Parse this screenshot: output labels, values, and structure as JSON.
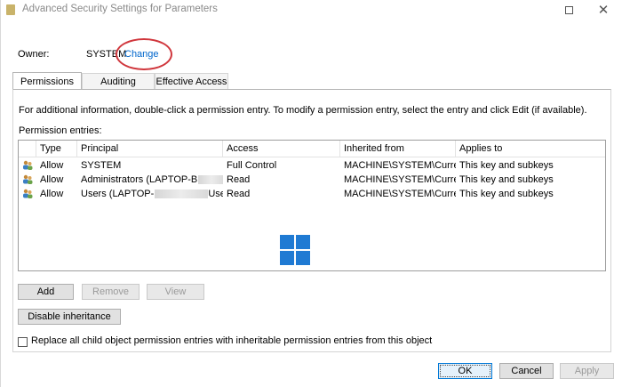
{
  "window": {
    "title": "Advanced Security Settings for Parameters"
  },
  "owner": {
    "label": "Owner:",
    "value": "SYSTEM",
    "change_link": "Change"
  },
  "tabs": [
    {
      "label": "Permissions",
      "active": true
    },
    {
      "label": "Auditing",
      "active": false
    },
    {
      "label": "Effective Access",
      "active": false
    }
  ],
  "info_text": "For additional information, double-click a permission entry. To modify a permission entry, select the entry and click Edit (if available).",
  "entries_label": "Permission entries:",
  "columns": [
    "Type",
    "Principal",
    "Access",
    "Inherited from",
    "Applies to"
  ],
  "rows": [
    {
      "type": "Allow",
      "principal": "SYSTEM",
      "principal_suffix": "",
      "access": "Full Control",
      "inherited": "MACHINE\\SYSTEM\\Curre...",
      "applies": "This key and subkeys"
    },
    {
      "type": "Allow",
      "principal": "Administrators (LAPTOP-B",
      "principal_suffix": "",
      "access": "Read",
      "inherited": "MACHINE\\SYSTEM\\Curre...",
      "applies": "This key and subkeys"
    },
    {
      "type": "Allow",
      "principal": "Users (LAPTOP-",
      "principal_suffix": "Users)",
      "access": "Read",
      "inherited": "MACHINE\\SYSTEM\\Curre...",
      "applies": "This key and subkeys"
    }
  ],
  "buttons": {
    "add": "Add",
    "remove": "Remove",
    "view": "View",
    "disable_inheritance": "Disable inheritance",
    "ok": "OK",
    "cancel": "Cancel",
    "apply": "Apply"
  },
  "replace_checkbox": {
    "label": "Replace all child object permission entries with inheritable permission entries from this object",
    "checked": false
  },
  "colors": {
    "link": "#0066cc",
    "highlight": "#d0363c",
    "ok_border": "#0078d7"
  }
}
